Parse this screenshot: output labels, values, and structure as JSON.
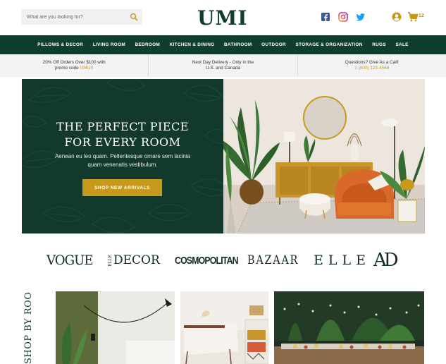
{
  "header": {
    "search": {
      "placeholder": "What are you looking for?"
    },
    "logo": "UMI",
    "cart_count": "12",
    "icons": [
      "search-icon",
      "facebook-icon",
      "instagram-icon",
      "twitter-icon",
      "account-icon",
      "cart-icon"
    ]
  },
  "nav": {
    "items": [
      "PILLOWS & DECOR",
      "LIVING ROOM",
      "BEDROOM",
      "KITCHEN & DINING",
      "BATHROOM",
      "OUTDOOR",
      "STORAGE & ORGANIZATION",
      "RUGS",
      "SALE"
    ]
  },
  "promo": {
    "offer_line1": "20% Off Orders Over $100 with",
    "offer_line2_prefix": "promo code ",
    "offer_code": "UMI20",
    "delivery_line1": "Next Day Delivery - Only in the",
    "delivery_line2": "U.S. and Canada",
    "call_line1": "Questions? Give As a Call!",
    "call_phone": "1 (800) 123-4568"
  },
  "hero": {
    "title_line1": "THE PERFECT PIECE",
    "title_line2": "FOR EVERY ROOM",
    "subtitle": "Aenean eu leo quam. Pellentesque ornare sem lacinia quam venenatis vestibulum.",
    "button": "SHOP NEW ARRIVALS"
  },
  "brands": {
    "vogue": "VOGUE",
    "elle_decor_prefix": "ELLE",
    "elle_decor": "DECOR",
    "cosmopolitan": "COSMOPOLITAN",
    "bazaar": "BAZAAR",
    "elle": "ELLE",
    "ad": "AD"
  },
  "shop_by_room": {
    "label": "SHOP BY ROOM"
  },
  "colors": {
    "brand_green": "#0f3d2e",
    "accent_gold": "#c79a1c",
    "promo_bg": "#f3f3f4"
  }
}
